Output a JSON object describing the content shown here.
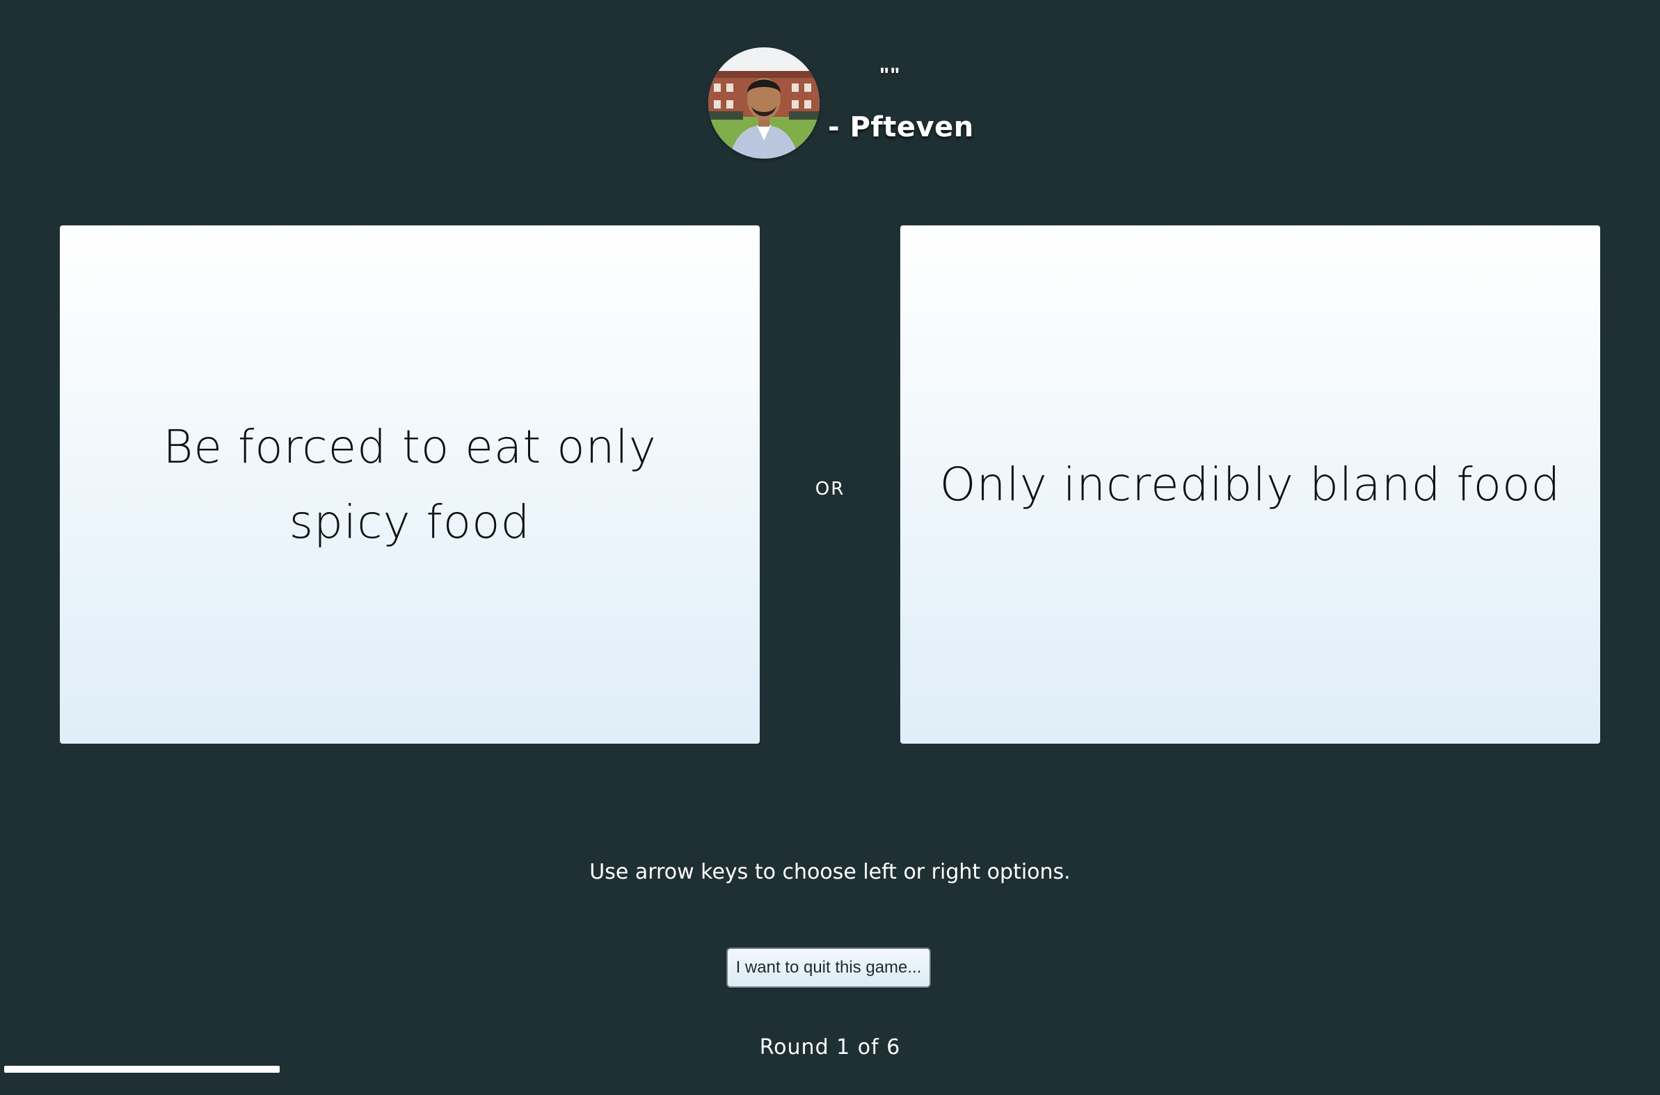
{
  "quote": {
    "marks": "\"\"",
    "author": "- Pfteven",
    "avatar_icon": "user-photo-avatar"
  },
  "options": {
    "left": "Be forced to eat only spicy food",
    "right": "Only incredibly bland food",
    "separator": "OR"
  },
  "hint": "Use arrow keys to choose left or right options.",
  "quit_button": "I want to quit this game...",
  "round": {
    "label": "Round 1 of 6",
    "current": 1,
    "total": 6
  },
  "colors": {
    "background": "#1f3034",
    "card_top": "#ffffff",
    "card_bottom": "#dfeef8",
    "text_light": "#ffffff"
  }
}
